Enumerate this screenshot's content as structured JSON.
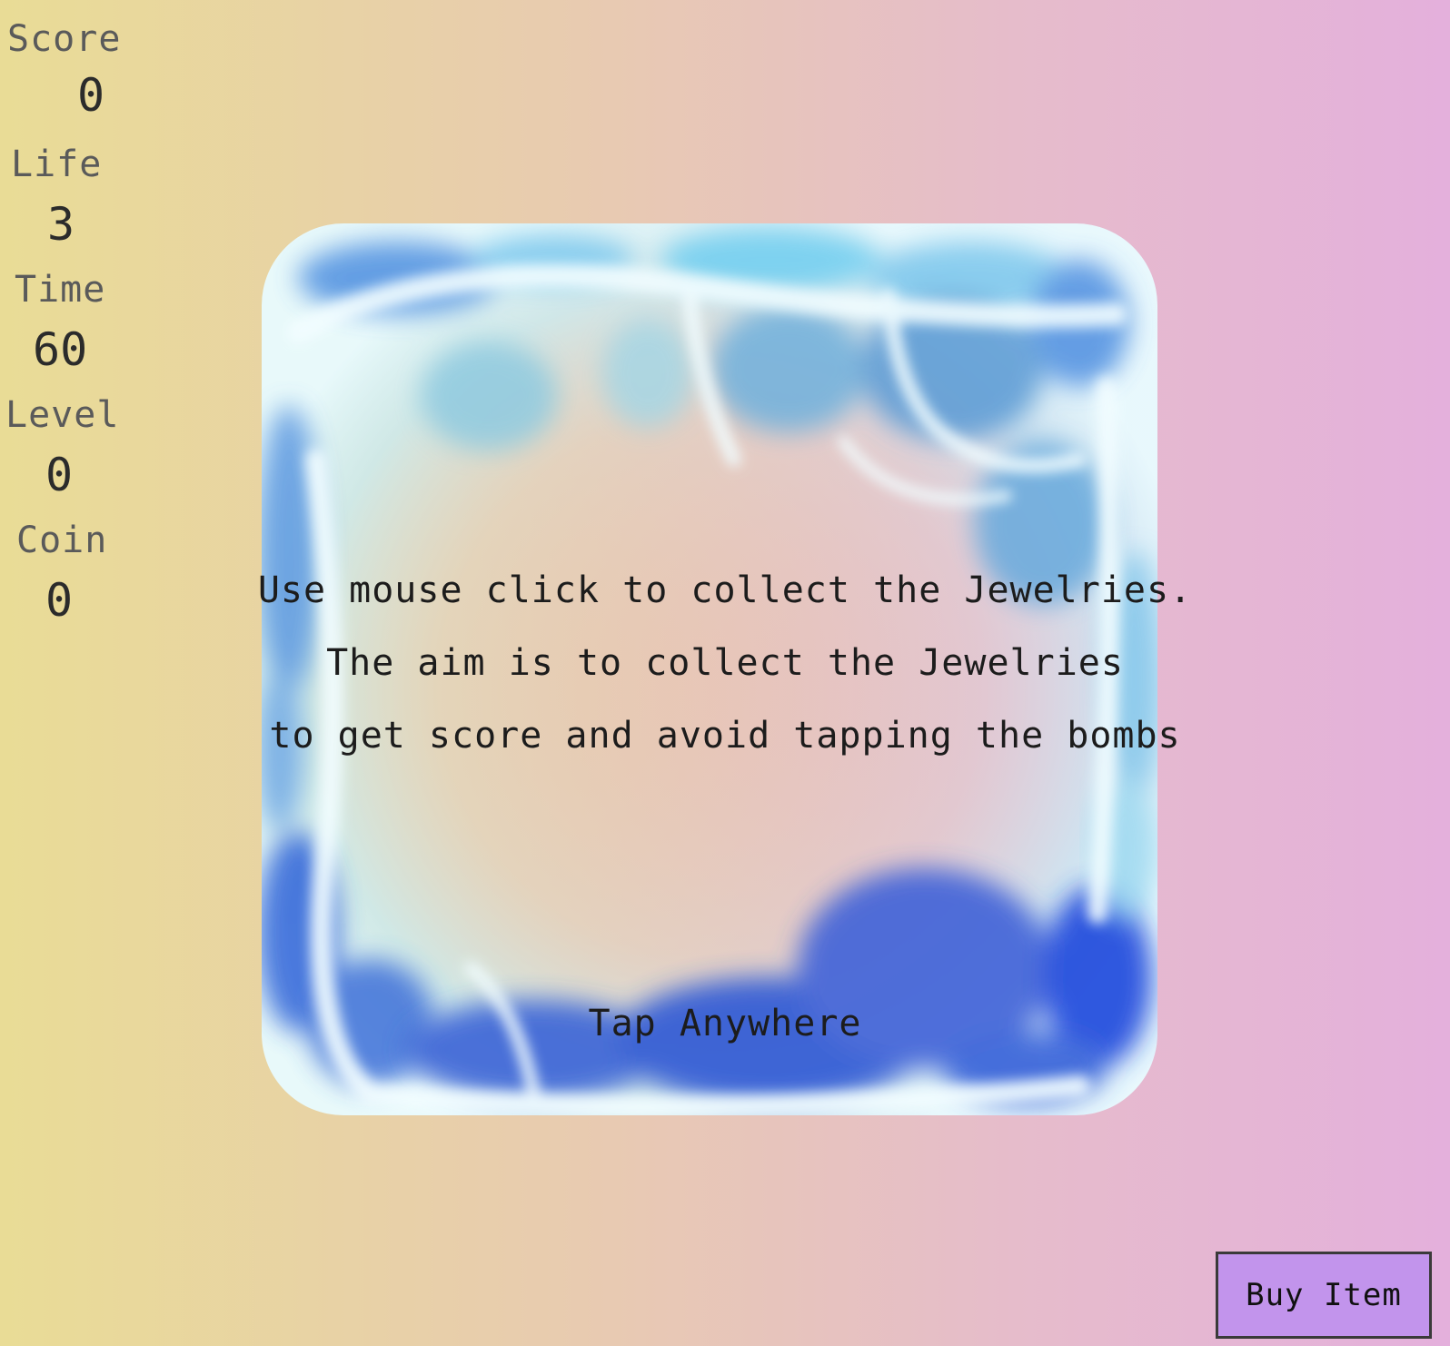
{
  "hud": {
    "score_label": "Score",
    "score_value": "0",
    "life_label": "Life",
    "life_value": "3",
    "time_label": "Time",
    "time_value": "60",
    "level_label": "Level",
    "level_value": "0",
    "coin_label": "Coin",
    "coin_value": "0"
  },
  "instructions": {
    "line1": "Use mouse click to collect the Jewelries.",
    "line2": "The aim is to collect the Jewelries",
    "line3": "to get score and avoid tapping the bombs"
  },
  "tap_prompt": "Tap Anywhere",
  "buy_button_label": "Buy Item",
  "colors": {
    "background_left": "#e9dc96",
    "background_right": "#e4b0dc",
    "button": "#c294ec",
    "ice_light": "#d8f6ff",
    "ice_dark": "#2e56d6"
  },
  "panel_icon": "ice-block"
}
